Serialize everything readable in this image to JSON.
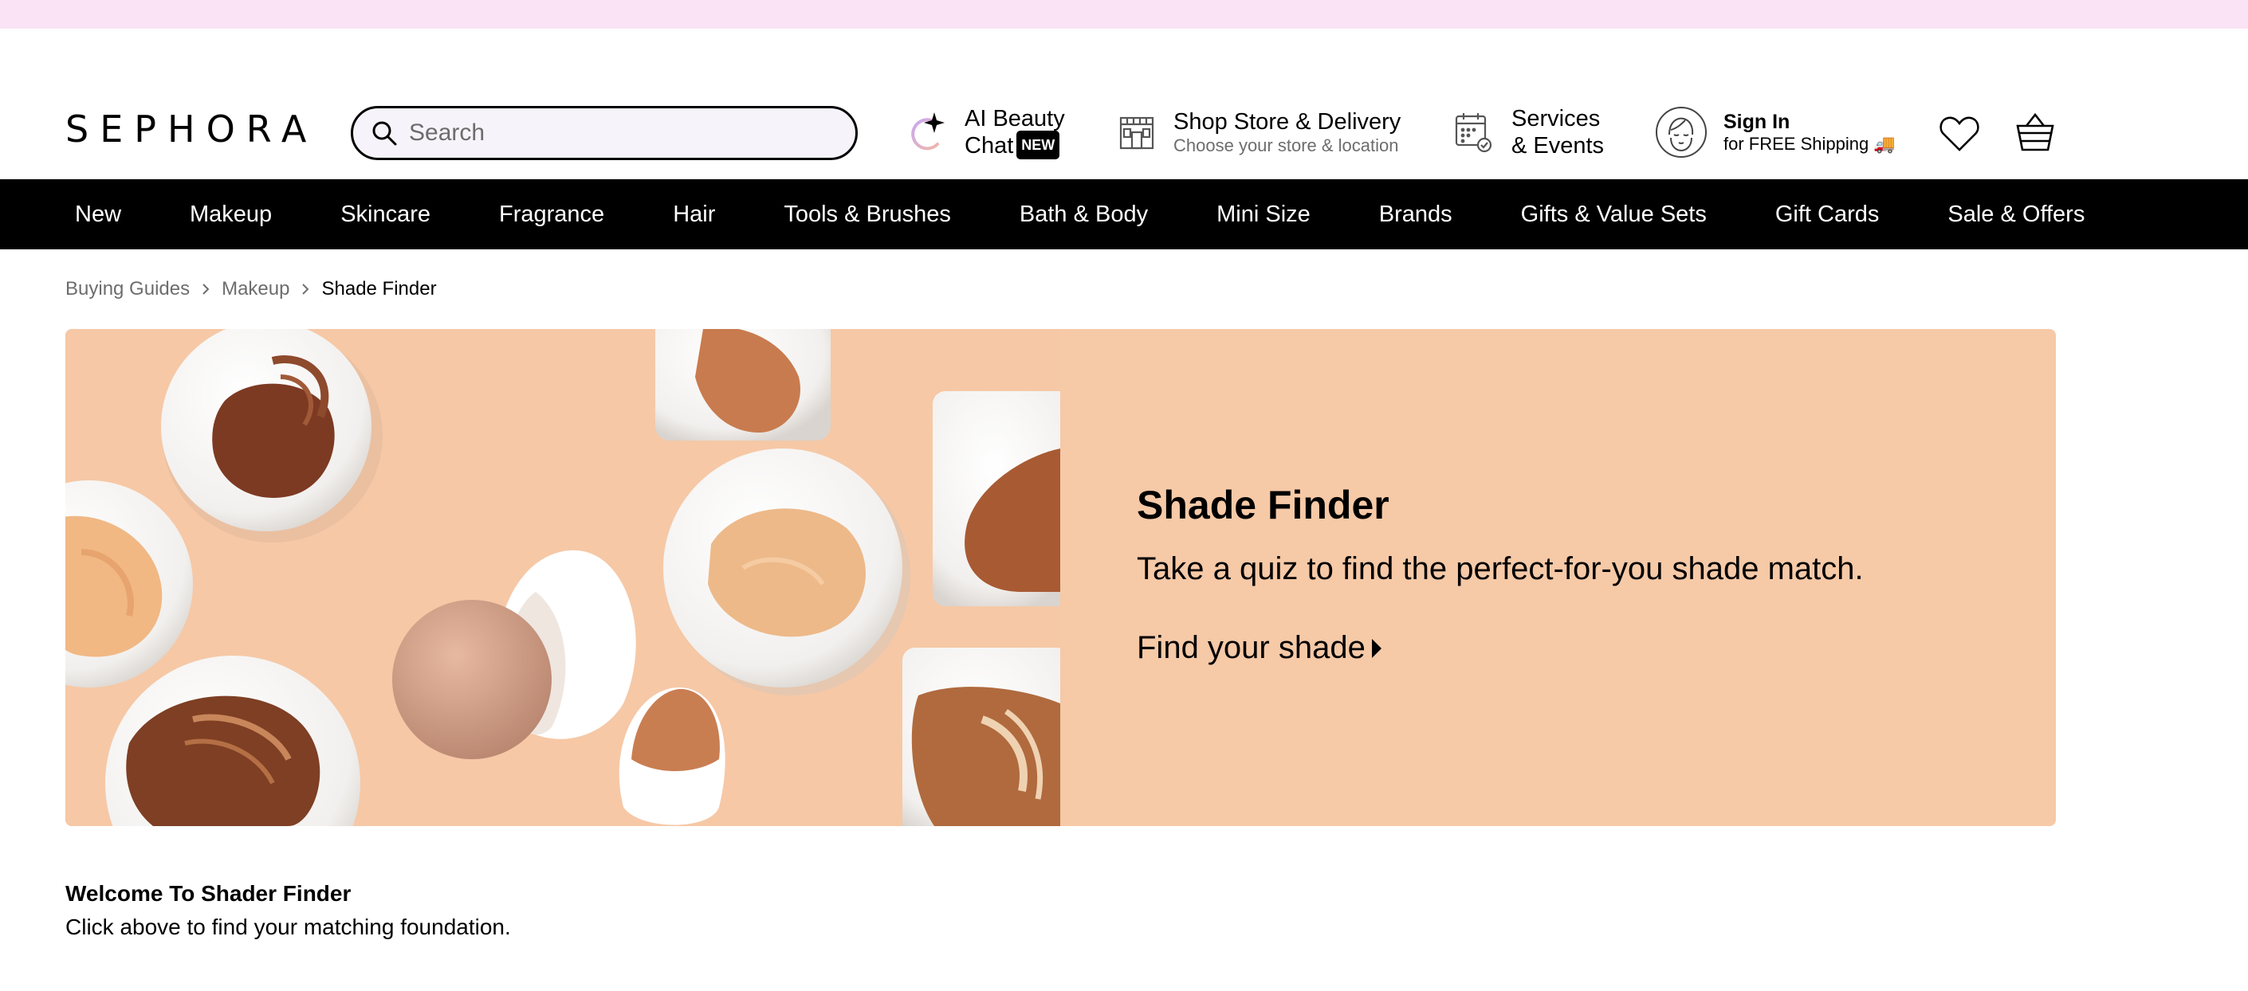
{
  "header": {
    "logo": "SEPHORA",
    "search_placeholder": "Search",
    "ai_chat": {
      "line1": "AI Beauty",
      "line2": "Chat",
      "badge": "NEW"
    },
    "store": {
      "title": "Shop Store & Delivery",
      "subtitle": "Choose your store & location"
    },
    "services": {
      "line1": "Services",
      "line2": "& Events"
    },
    "signin": {
      "title": "Sign In",
      "subtitle": "for FREE Shipping 🚚"
    }
  },
  "nav": {
    "items": [
      "New",
      "Makeup",
      "Skincare",
      "Fragrance",
      "Hair",
      "Tools & Brushes",
      "Bath & Body",
      "Mini Size",
      "Brands",
      "Gifts & Value Sets",
      "Gift Cards",
      "Sale & Offers"
    ]
  },
  "breadcrumb": {
    "items": [
      "Buying Guides",
      "Makeup"
    ],
    "current": "Shade Finder"
  },
  "hero": {
    "title": "Shade Finder",
    "subtitle": "Take a quiz to find the perfect-for-you shade match.",
    "cta": "Find your shade"
  },
  "welcome": {
    "title": "Welcome To Shader Finder",
    "body": "Click above to find your matching foundation."
  },
  "colors": {
    "promo_strip": "#f9e3f5",
    "nav_bg": "#000000",
    "hero_bg": "#f6c9a7"
  }
}
